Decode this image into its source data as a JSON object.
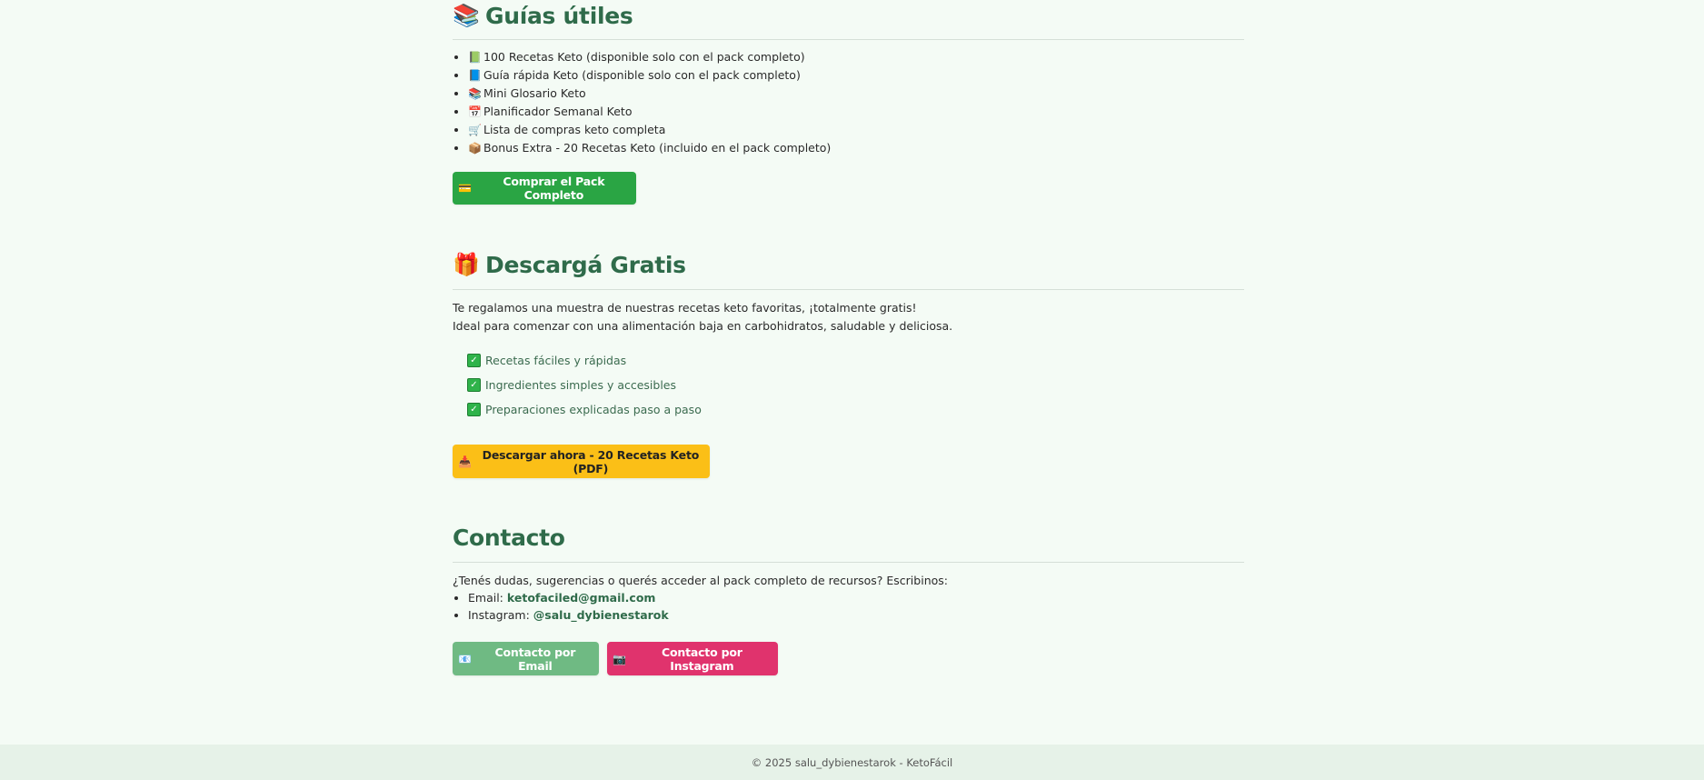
{
  "guides": {
    "title_emoji": "📚",
    "title": "Guías útiles",
    "items": [
      {
        "emoji": "📗",
        "text": "100 Recetas Keto (disponible solo con el pack completo)"
      },
      {
        "emoji": "📘",
        "text": "Guía rápida Keto (disponible solo con el pack completo)"
      },
      {
        "emoji": "📚",
        "text": "Mini Glosario Keto"
      },
      {
        "emoji": "📅",
        "text": "Planificador Semanal Keto"
      },
      {
        "emoji": "🛒",
        "text": "Lista de compras keto completa"
      },
      {
        "emoji": "📦",
        "text": "Bonus Extra - 20 Recetas Keto (incluido en el pack completo)"
      }
    ],
    "buy_button": {
      "emoji": "💳",
      "label": "Comprar el Pack Completo"
    }
  },
  "free_download": {
    "title_emoji": "🎁",
    "title": "Descargá Gratis",
    "desc_line1": "Te regalamos una muestra de nuestras recetas keto favoritas, ¡totalmente gratis!",
    "desc_line2": "Ideal para comenzar con una alimentación baja en carbohidratos, saludable y deliciosa.",
    "checks": [
      "Recetas fáciles y rápidas",
      "Ingredientes simples y accesibles",
      "Preparaciones explicadas paso a paso"
    ],
    "check_icon": "✓",
    "download_button": {
      "emoji": "📥",
      "label": "Descargar ahora - 20 Recetas Keto (PDF)"
    }
  },
  "contact": {
    "title": "Contacto",
    "intro": "¿Tenés dudas, sugerencias o querés acceder al pack completo de recursos? Escribinos:",
    "email_label": "Email:",
    "email_value": "ketofaciled@gmail.com",
    "instagram_label": "Instagram:",
    "instagram_value": "@salu_dybienestarok",
    "email_button": {
      "emoji": "📧",
      "label": "Contacto por Email"
    },
    "instagram_button": {
      "emoji": "📷",
      "label": "Contacto por Instagram"
    }
  },
  "footer": {
    "text": "© 2025 salu_dybienestarok - KetoFácil"
  },
  "colors": {
    "background": "#f4fbf5",
    "heading": "#2f6b4a",
    "buy_button": "#2aa544",
    "download_button": "#fbbf17",
    "email_button": "#6fba83",
    "instagram_button": "#e0336d",
    "footer_bg": "#e6f2e8"
  }
}
